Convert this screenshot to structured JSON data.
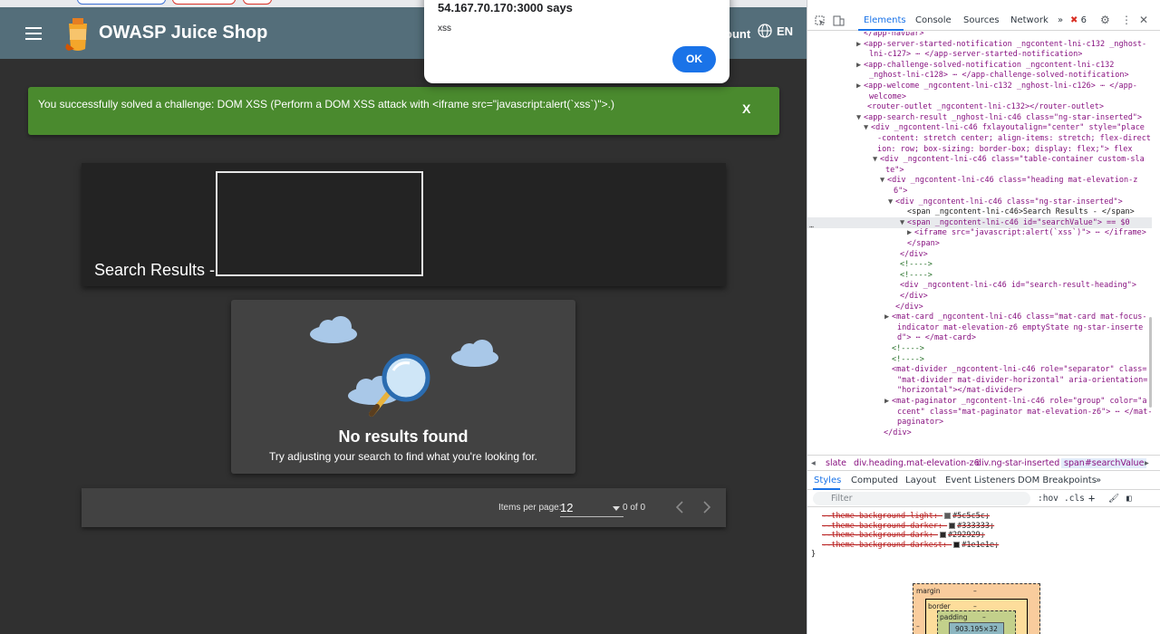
{
  "app": {
    "title": "OWASP Juice Shop",
    "account_label": "ount",
    "language_label": "EN",
    "toast": {
      "message": "You successfully solved a challenge: DOM XSS (Perform a DOM XSS attack with <iframe src=\"javascript:alert(`xss`)\">.)",
      "close_label": "X"
    },
    "search_results_label": "Search Results -",
    "empty_state": {
      "title": "No results found",
      "subtitle": "Try adjusting your search to find what you're looking for."
    },
    "paginator": {
      "items_per_page_label": "Items per page:",
      "items_per_page_value": "12",
      "range_label": "0 of 0"
    }
  },
  "alert": {
    "origin": "54.167.70.170:3000 says",
    "message": "xss",
    "ok_label": "OK"
  },
  "devtools": {
    "tabs": [
      "Elements",
      "Console",
      "Sources",
      "Network",
      "»"
    ],
    "error_count": "6",
    "dom_lines": [
      "</app-navbar>",
      "<app-server-started-notification _ngcontent-lni-c132 _nghost-",
      "lni-c127> ⋯ </app-server-started-notification>",
      "<app-challenge-solved-notification _ngcontent-lni-c132",
      "_nghost-lni-c128> ⋯ </app-challenge-solved-notification>",
      "<app-welcome _ngcontent-lni-c132 _nghost-lni-c126> ⋯ </app-",
      "welcome>",
      "<router-outlet _ngcontent-lni-c132></router-outlet>",
      "<app-search-result _nghost-lni-c46 class=\"ng-star-inserted\">",
      "<div _ngcontent-lni-c46 fxlayoutalign=\"center\" style=\"place",
      "-content: stretch center; align-items: stretch; flex-direct",
      "ion: row; box-sizing: border-box; display: flex;\"> flex",
      "<div _ngcontent-lni-c46 class=\"table-container custom-sla",
      "te\">",
      "<div _ngcontent-lni-c46 class=\"heading mat-elevation-z",
      "6\">",
      "<div _ngcontent-lni-c46 class=\"ng-star-inserted\">",
      "<span _ngcontent-lni-c46>Search Results - </span>",
      "<span _ngcontent-lni-c46 id=\"searchValue\"> == $0",
      "<iframe src=\"javascript:alert(`xss`)\"> ⋯ </iframe>",
      "</span>",
      "</div>",
      "<!---->",
      "<!---->",
      "<div _ngcontent-lni-c46 id=\"search-result-heading\">",
      "</div>",
      "</div>",
      "<mat-card _ngcontent-lni-c46 class=\"mat-card mat-focus-",
      "indicator mat-elevation-z6 emptyState ng-star-inserte",
      "d\"> ⋯ </mat-card>",
      "<!---->",
      "<!---->",
      "<mat-divider _ngcontent-lni-c46 role=\"separator\" class=",
      "\"mat-divider mat-divider-horizontal\" aria-orientation=",
      "\"horizontal\"></mat-divider>",
      "<mat-paginator _ngcontent-lni-c46 role=\"group\" color=\"a",
      "ccent\" class=\"mat-paginator mat-elevation-z6\"> ⋯ </mat-",
      "paginator>",
      "</div>"
    ],
    "breadcrumbs": [
      "slate",
      "div.heading.mat-elevation-z6",
      "div.ng-star-inserted",
      "span#searchValue"
    ],
    "styles_tabs": [
      "Styles",
      "Computed",
      "Layout",
      "Event Listeners",
      "DOM Breakpoints",
      "»"
    ],
    "filter_placeholder": "Filter",
    "filter_tools": [
      ":hov",
      ".cls",
      "+"
    ],
    "css_lines": [
      {
        "text": "--theme-background-light: ",
        "value": "#5c5c5c;",
        "color": "#5c5c5c"
      },
      {
        "text": "--theme-background-darker: ",
        "value": "#333333;",
        "color": "#333333"
      },
      {
        "text": "--theme-background-dark: ",
        "value": "#292929;",
        "color": "#292929"
      },
      {
        "text": "--theme-background-darkest: ",
        "value": "#1e1e1e;",
        "color": "#1e1e1e"
      }
    ],
    "css_close": "}",
    "boxmodel": {
      "margin_label": "margin",
      "border_label": "border",
      "padding_label": "padding",
      "dash": "–",
      "content_size": "903.195×32"
    }
  }
}
